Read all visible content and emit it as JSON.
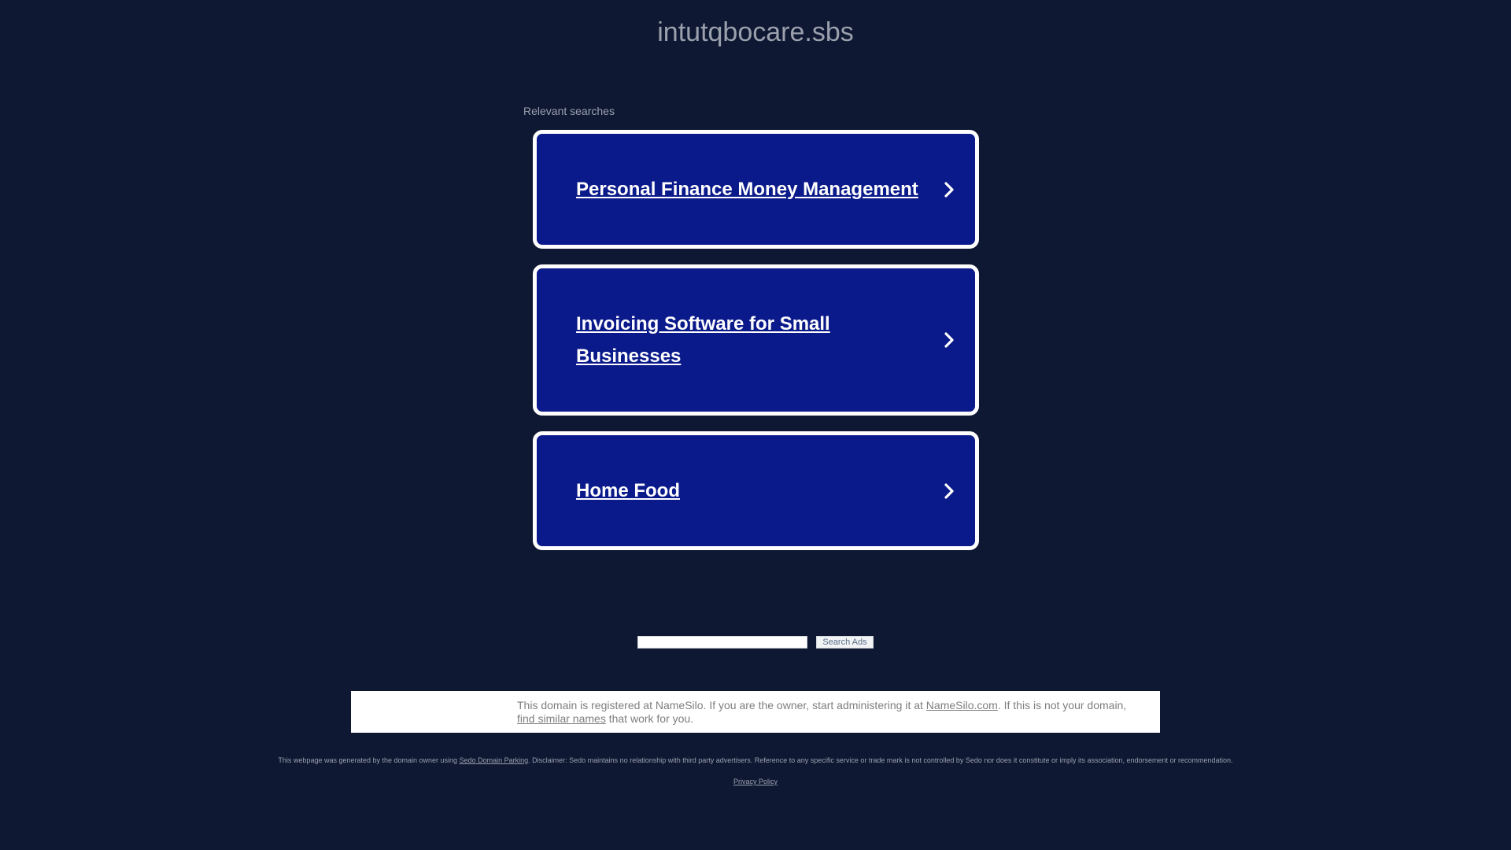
{
  "header": {
    "domain": "intutqbocare.sbs"
  },
  "relevant": {
    "label": "Relevant searches",
    "items": [
      {
        "label": "Personal Finance Money Management"
      },
      {
        "label": "Invoicing Software for Small Businesses"
      },
      {
        "label": "Home Food"
      }
    ]
  },
  "search": {
    "input_value": "",
    "button_label": "Search Ads"
  },
  "notice": {
    "text_1": "This domain is registered at NameSilo. If you are the owner, start administering it at ",
    "link_namesilo": "NameSilo.com",
    "text_2": ". If this is not your domain, ",
    "link_similar": "find similar names",
    "text_3": " that work for you."
  },
  "footer": {
    "text_1": "This webpage was generated by the domain owner using ",
    "link_sedo": "Sedo Domain Parking",
    "text_2": ". Disclaimer: Sedo maintains no relationship with third party advertisers. Reference to any specific service or trade mark is not controlled by Sedo nor does it constitute or imply its association, endorsement or recommendation.",
    "privacy": "Privacy Policy"
  },
  "colors": {
    "background": "#0f1833",
    "card_fill": "#0b1a8a",
    "card_border": "#ffffff"
  },
  "icons": {
    "card_arrow": "chevron-right-icon"
  }
}
